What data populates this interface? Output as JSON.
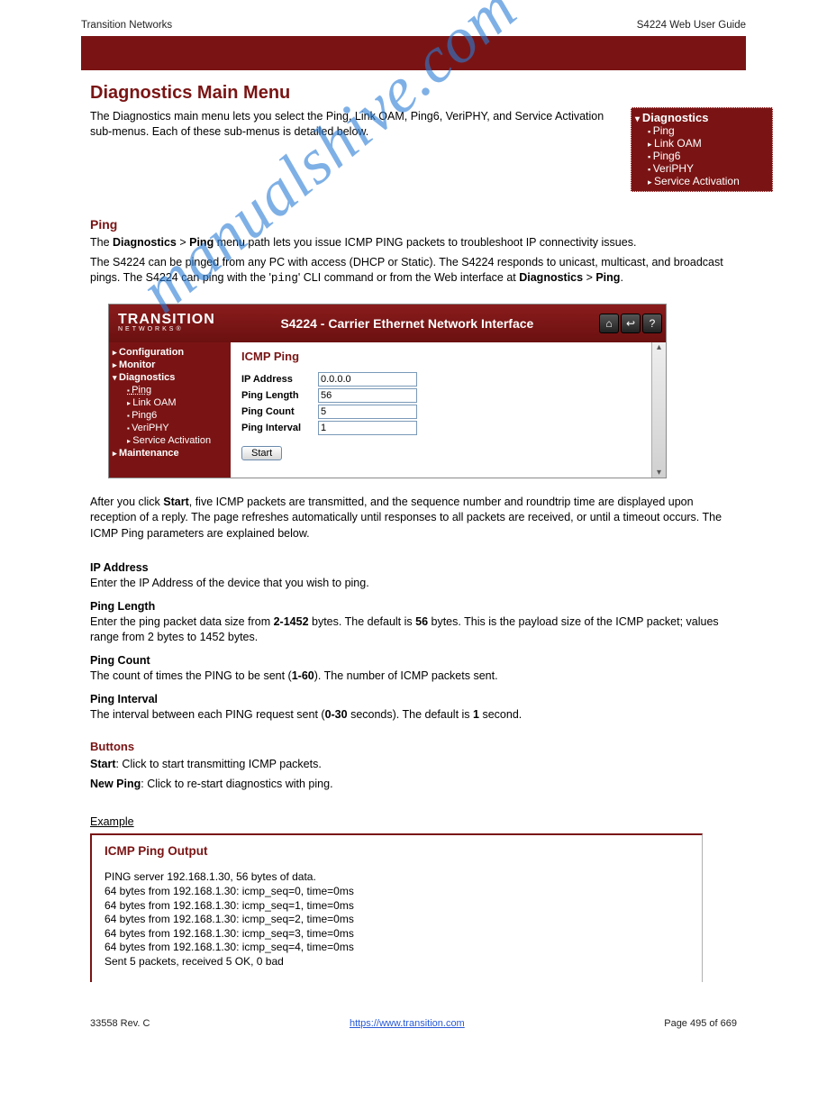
{
  "header": {
    "left": "Transition Networks",
    "right": "S4224 Web User Guide"
  },
  "section_title": "Diagnostics Main Menu",
  "intro": "The Diagnostics main menu lets you select the Ping, Link OAM, Ping6, VeriPHY, and Service Activation sub-menus. Each of these sub-menus is detailed below.",
  "mini_nav": {
    "header": "Diagnostics",
    "items": [
      {
        "label": "Ping",
        "style": "bullet"
      },
      {
        "label": "Link OAM",
        "style": "arrow"
      },
      {
        "label": "Ping6",
        "style": "bullet"
      },
      {
        "label": "VeriPHY",
        "style": "bullet"
      },
      {
        "label": "Service Activation",
        "style": "arrow"
      }
    ]
  },
  "subhead_ping": "Ping",
  "ping_para1_a": "The ",
  "ping_para1_b": "Diagnostics",
  "ping_para1_c": " > ",
  "ping_para1_d": "Ping",
  "ping_para1_e": " menu path lets you issue ICMP PING packets to troubleshoot IP connectivity issues.",
  "ping_para2_a": "The S4224 can be ",
  "ping_para2_b": "pinged",
  "ping_para2_c": " from any PC with access (DHCP or Static). The S4224 responds to unicast, multicast, and broadcast pings. The S4224 can ping with the '",
  "ping_para2_d": "ping",
  "ping_para2_e": "' CLI command or from the Web interface at ",
  "ping_para2_f": "Diagnostics",
  "ping_para2_g": " > ",
  "ping_para2_h": "Ping",
  "ping_para2_i": ".",
  "ui": {
    "logo_main": "TRANSITION",
    "logo_sub": "NETWORKS®",
    "title": "S4224 - Carrier Ethernet Network Interface",
    "sidebar": {
      "groups": [
        {
          "label": "Configuration",
          "open": false,
          "items": []
        },
        {
          "label": "Monitor",
          "open": false,
          "items": []
        },
        {
          "label": "Diagnostics",
          "open": true,
          "items": [
            {
              "label": "Ping",
              "style": "bullet",
              "current": true
            },
            {
              "label": "Link OAM",
              "style": "arrow"
            },
            {
              "label": "Ping6",
              "style": "bullet"
            },
            {
              "label": "VeriPHY",
              "style": "bullet"
            },
            {
              "label": "Service Activation",
              "style": "arrow"
            }
          ]
        },
        {
          "label": "Maintenance",
          "open": false,
          "items": []
        }
      ]
    },
    "panel_heading": "ICMP Ping",
    "fields": {
      "ip_label": "IP Address",
      "ip_value": "0.0.0.0",
      "len_label": "Ping Length",
      "len_value": "56",
      "cnt_label": "Ping Count",
      "cnt_value": "5",
      "int_label": "Ping Interval",
      "int_value": "1"
    },
    "start_label": "Start"
  },
  "start_para_a": "After you click ",
  "start_para_b": "Start",
  "start_para_c": ", five ICMP packets are transmitted, and the sequence number and roundtrip time are displayed upon reception of a reply. The page refreshes automatically until responses to all packets are received, or until a timeout occurs. The ICMP Ping parameters are explained below.",
  "params": {
    "ip": {
      "title": "IP Address",
      "desc": "Enter the IP Address of the device that you wish to ping."
    },
    "len": {
      "title": "Ping Length",
      "desc_a": "Enter the ping packet data size from ",
      "range": "2-1452",
      "desc_b": " bytes. The default is ",
      "def": "56",
      "desc_c": " bytes. This is the payload size of the ICMP packet; values range from 2 bytes to 1452 bytes."
    },
    "cnt": {
      "title": "Ping Count",
      "desc_a": "The count of times the PING to be sent (",
      "range": "1-60",
      "desc_b": "). The number of ICMP packets sent."
    },
    "intv": {
      "title": "Ping Interval",
      "desc_a": "The interval between each PING request sent (",
      "range": "0-30",
      "desc_b": " seconds). The default is ",
      "def": "1",
      "desc_c": " second."
    }
  },
  "buttons_heading": "Buttons",
  "buttons_start_a": "Start",
  "buttons_start_b": ": Click to start transmitting ICMP packets.",
  "buttons_new_a": "New Ping",
  "buttons_new_b": ": Click to re-start diagnostics with ping.",
  "example_label": "Example",
  "output": {
    "heading": "ICMP Ping Output",
    "lines": [
      "PING server 192.168.1.30, 56 bytes of data.",
      "64 bytes from 192.168.1.30: icmp_seq=0, time=0ms",
      "64 bytes from 192.168.1.30: icmp_seq=1, time=0ms",
      "64 bytes from 192.168.1.30: icmp_seq=2, time=0ms",
      "64 bytes from 192.168.1.30: icmp_seq=3, time=0ms",
      "64 bytes from 192.168.1.30: icmp_seq=4, time=0ms",
      "Sent 5 packets, received 5 OK, 0 bad"
    ]
  },
  "footer": {
    "left": "33558 Rev. C",
    "mid": "https://www.transition.com",
    "right": "Page 495 of 669"
  },
  "watermark": "manualshive.com"
}
